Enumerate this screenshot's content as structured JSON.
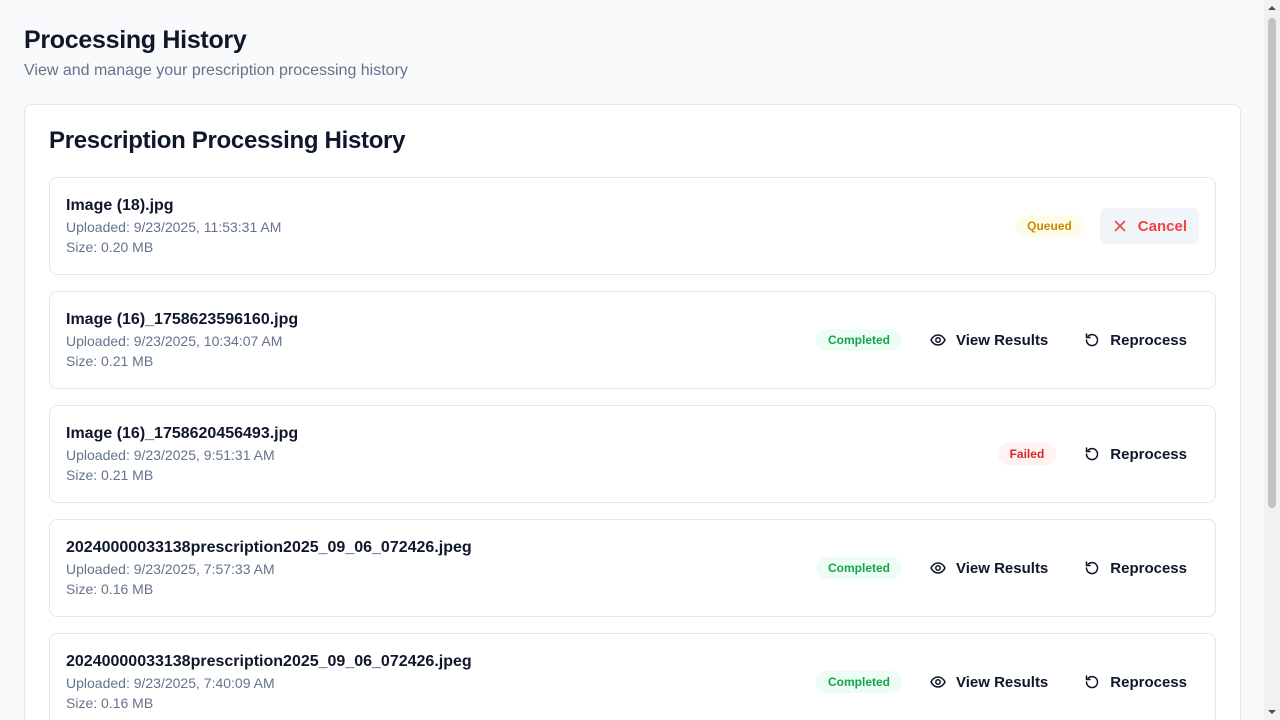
{
  "header": {
    "title": "Processing History",
    "subtitle": "View and manage your prescription processing history"
  },
  "card": {
    "title": "Prescription Processing History"
  },
  "items": [
    {
      "file_name": "Image (18).jpg",
      "uploaded": "Uploaded: 9/23/2025, 11:53:31 AM",
      "size": "Size: 0.20 MB",
      "status": "Queued",
      "actions": {
        "cancel": "Cancel"
      }
    },
    {
      "file_name": "Image (16)_1758623596160.jpg",
      "uploaded": "Uploaded: 9/23/2025, 10:34:07 AM",
      "size": "Size: 0.21 MB",
      "status": "Completed",
      "actions": {
        "view": "View Results",
        "reprocess": "Reprocess"
      }
    },
    {
      "file_name": "Image (16)_1758620456493.jpg",
      "uploaded": "Uploaded: 9/23/2025, 9:51:31 AM",
      "size": "Size: 0.21 MB",
      "status": "Failed",
      "actions": {
        "reprocess": "Reprocess"
      }
    },
    {
      "file_name": "20240000033138prescription2025_09_06_072426.jpeg",
      "uploaded": "Uploaded: 9/23/2025, 7:57:33 AM",
      "size": "Size: 0.16 MB",
      "status": "Completed",
      "actions": {
        "view": "View Results",
        "reprocess": "Reprocess"
      }
    },
    {
      "file_name": "20240000033138prescription2025_09_06_072426.jpeg",
      "uploaded": "Uploaded: 9/23/2025, 7:40:09 AM",
      "size": "Size: 0.16 MB",
      "status": "Completed",
      "actions": {
        "view": "View Results",
        "reprocess": "Reprocess"
      }
    }
  ],
  "icons": {
    "view": "eye-icon",
    "reprocess": "rotate-ccw-icon",
    "cancel": "x-icon"
  },
  "colors": {
    "completed": "#16a34a",
    "queued": "#ca8a04",
    "failed": "#dc2626",
    "cancel": "#ef4444"
  }
}
